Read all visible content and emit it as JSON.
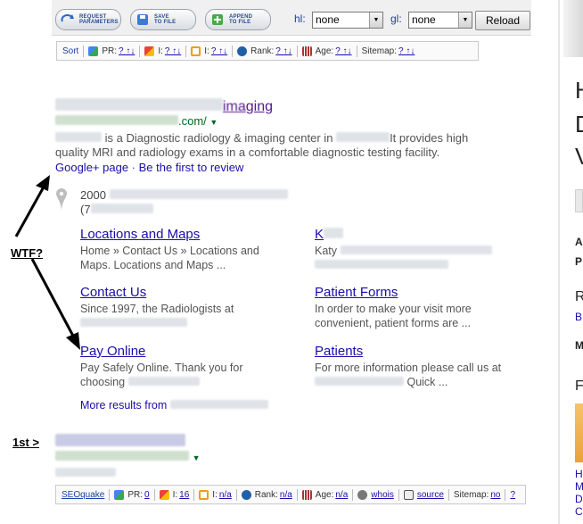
{
  "toolbar": {
    "buttons": [
      {
        "label": "REQUEST\nPARAMETERS",
        "icon": "refresh-icon"
      },
      {
        "label": "SAVE\nTO FILE",
        "icon": "save-icon"
      },
      {
        "label": "APPEND\nTO FILE",
        "icon": "append-icon"
      }
    ],
    "hl_label": "hl:",
    "hl_value": "none",
    "gl_label": "gl:",
    "gl_value": "none",
    "reload_label": "Reload"
  },
  "seobar_top": {
    "sort": "Sort",
    "pr": "PR:",
    "pr_val": "? ↑↓",
    "i1": "I:",
    "i1_val": "? ↑↓",
    "i2": "I:",
    "i2_val": "? ↑↓",
    "rank": "Rank:",
    "rank_val": "? ↑↓",
    "age": "Age:",
    "age_val": "? ↑↓",
    "sitemap": "Sitemap:",
    "sitemap_val": "? ↑↓"
  },
  "result1": {
    "title_suffix": "ging",
    "url_suffix": ".com/",
    "snippet_line1": "is a Diagnostic radiology & imaging center in",
    "snippet_line1b": "It provides high",
    "snippet_line2": "quality MRI and radiology exams in a comfortable diagnostic testing facility.",
    "google_plus": "Google+ page",
    "dot": "·",
    "review": "Be the first to review",
    "address_start": "2000",
    "phone_start": "(7"
  },
  "sitelinks": [
    {
      "title": "Locations and Maps",
      "text": "Home » Contact Us » Locations and Maps. Locations and Maps ..."
    },
    {
      "title": "Contact Us",
      "text": "Since 1997, the Radiologists at"
    },
    {
      "title": "Pay Online",
      "text": "Pay Safely Online. Thank you for choosing"
    },
    {
      "title": "K",
      "text": "Katy"
    },
    {
      "title": "Patient Forms",
      "text": "In order to make your visit more convenient, patient forms are ..."
    },
    {
      "title": "Patients",
      "text": "For more information please call us at",
      "text2": "Quick ..."
    }
  ],
  "more_results": "More results from",
  "annotations": {
    "wtf": "WTF?",
    "first": "1st >"
  },
  "seobar_bottom": {
    "brand": "SEOquake",
    "pr": "PR:",
    "pr_val": "0",
    "i1": "I:",
    "i1_val": "16",
    "i2": "I:",
    "i2_val": "n/a",
    "rank": "Rank:",
    "rank_val": "n/a",
    "age": "Age:",
    "age_val": "n/a",
    "whois": "whois",
    "source": "source",
    "sitemap": "Sitemap:",
    "sitemap_val": "no",
    "help": "?"
  },
  "right_column": {
    "letters_big": [
      "H",
      "D",
      "V"
    ],
    "letters_small": [
      "A",
      "P",
      "R",
      "B",
      "M",
      "F"
    ]
  },
  "colors": {
    "link": "#1a0dab",
    "visited": "#551a8b",
    "url_green": "#006621",
    "snippet": "#545454"
  }
}
